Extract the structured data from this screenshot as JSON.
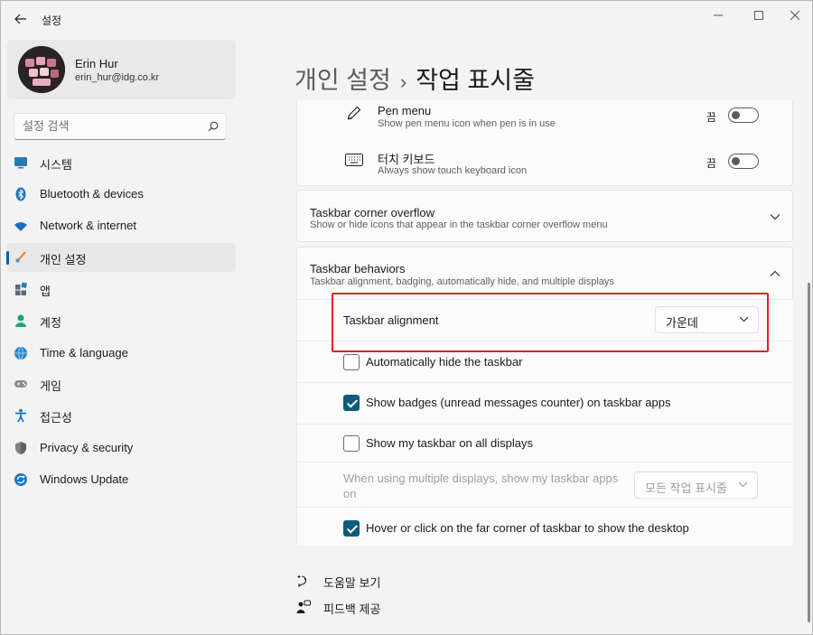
{
  "window": {
    "title": "설정"
  },
  "profile": {
    "name": "Erin Hur",
    "email": "erin_hur@idg.co.kr"
  },
  "search": {
    "placeholder": "설정 검색"
  },
  "nav": {
    "items": [
      {
        "label": "시스템",
        "icon": "monitor-icon"
      },
      {
        "label": "Bluetooth & devices",
        "icon": "bluetooth-icon"
      },
      {
        "label": "Network & internet",
        "icon": "wifi-icon"
      },
      {
        "label": "개인 설정",
        "icon": "brush-icon",
        "active": true
      },
      {
        "label": "앱",
        "icon": "apps-icon"
      },
      {
        "label": "계정",
        "icon": "person-icon"
      },
      {
        "label": "Time & language",
        "icon": "globe-clock-icon"
      },
      {
        "label": "게임",
        "icon": "gamepad-icon"
      },
      {
        "label": "접근성",
        "icon": "accessibility-icon"
      },
      {
        "label": "Privacy & security",
        "icon": "shield-icon"
      },
      {
        "label": "Windows Update",
        "icon": "update-icon"
      }
    ]
  },
  "breadcrumb": {
    "parent": "개인 설정",
    "separator": "›",
    "current": "작업 표시줄"
  },
  "pen_menu": {
    "title": "Pen menu",
    "subtitle": "Show pen menu icon when pen is in use",
    "state": "끔"
  },
  "touch_keyboard": {
    "title": "터치 키보드",
    "subtitle": "Always show touch keyboard icon",
    "state": "끔"
  },
  "corner_overflow": {
    "title": "Taskbar corner overflow",
    "subtitle": "Show or hide icons that appear in the taskbar corner overflow menu"
  },
  "behaviors": {
    "title": "Taskbar behaviors",
    "subtitle": "Taskbar alignment, badging, automatically hide, and multiple displays",
    "alignment_label": "Taskbar alignment",
    "alignment_value": "가운데",
    "auto_hide": "Automatically hide the taskbar",
    "badges": "Show badges (unread messages counter) on taskbar apps",
    "all_displays": "Show my taskbar on all displays",
    "multi_display_line1": "When using multiple displays, show my taskbar apps",
    "multi_display_line2": "on",
    "multi_display_value": "모든 작업 표시줄",
    "far_corner": "Hover or click on the far corner of taskbar to show the desktop"
  },
  "footer": {
    "help": "도움말 보기",
    "feedback": "피드백 제공"
  },
  "colors": {
    "accent": "#005fb8",
    "checkbox": "#0e5a7a",
    "highlight": "#e41e26"
  }
}
